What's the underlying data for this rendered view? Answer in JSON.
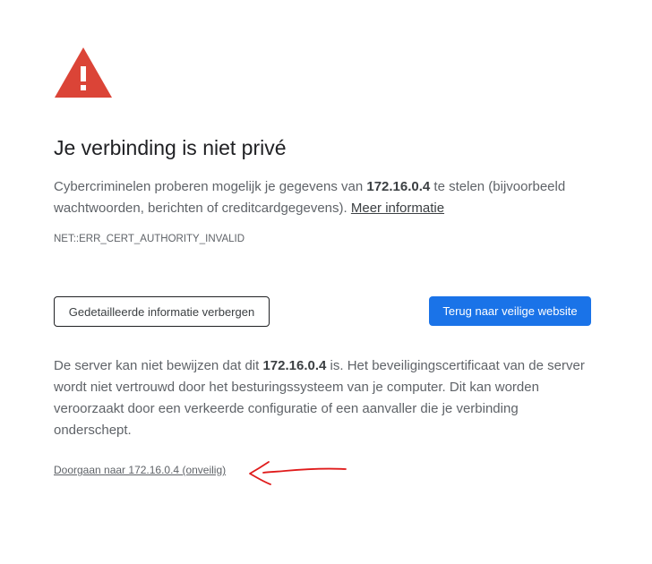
{
  "interstitial": {
    "icon": "warning-triangle-icon",
    "title": "Je verbinding is niet privé",
    "intro": {
      "part1": "Cybercriminelen proberen mogelijk je gegevens van ",
      "host": "172.16.0.4",
      "part2": " te stelen (bijvoorbeeld wachtwoorden, berichten of creditcardgegevens). ",
      "learn_more": "Meer informatie"
    },
    "error_code": "NET::ERR_CERT_AUTHORITY_INVALID",
    "buttons": {
      "details": "Gedetailleerde informatie verbergen",
      "back": "Terug naar veilige website"
    },
    "details": {
      "part1": "De server kan niet bewijzen dat dit ",
      "host": "172.16.0.4",
      "part2": " is. Het beveiligingscertificaat van de server wordt niet vertrouwd door het besturingssysteem van je computer. Dit kan worden veroorzaakt door een verkeerde configuratie of een aanvaller die je verbinding onderschept."
    },
    "proceed_link": "Doorgaan naar 172.16.0.4 (onveilig)"
  },
  "annotation": {
    "icon": "red-arrow-annotation-icon",
    "color": "#e01b1b"
  },
  "colors": {
    "warning_red": "#db4437",
    "accent_blue": "#1a73e8",
    "text_primary": "#202124",
    "text_secondary": "#5f6368"
  }
}
